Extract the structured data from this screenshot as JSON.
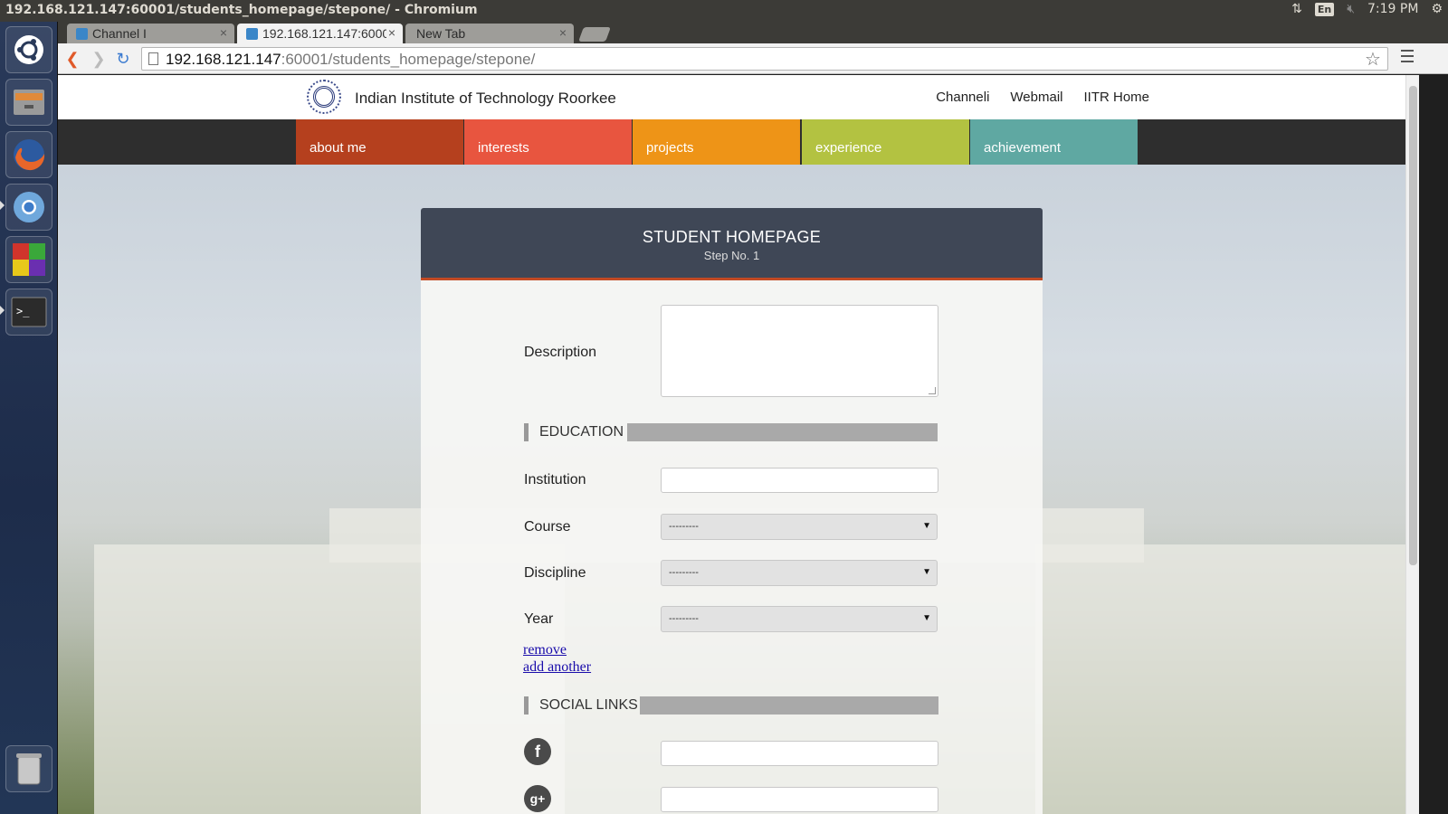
{
  "window": {
    "title": "192.168.121.147:60001/students_homepage/stepone/ - Chromium"
  },
  "tray": {
    "lang": "En",
    "clock": "7:19 PM"
  },
  "browser": {
    "tabs": [
      {
        "label": "Channel I"
      },
      {
        "label": "192.168.121.147:6000"
      },
      {
        "label": "New Tab"
      }
    ],
    "url_host": "192.168.121.147",
    "url_rest": ":60001/students_homepage/stepone/"
  },
  "site": {
    "title": "Indian Institute of Technology Roorkee",
    "links": [
      "Channeli",
      "Webmail",
      "IITR Home"
    ],
    "nav": [
      {
        "label": "about me",
        "color": "#b5401e"
      },
      {
        "label": "interests",
        "color": "#e8553f"
      },
      {
        "label": "projects",
        "color": "#ee9417"
      },
      {
        "label": "experience",
        "color": "#b3c241"
      },
      {
        "label": "achievement",
        "color": "#5fa8a2"
      }
    ]
  },
  "form": {
    "heading": "STUDENT HOMEPAGE",
    "step": "Step No. 1",
    "description_label": "Description",
    "education_section": "EDUCATION",
    "institution_label": "Institution",
    "course_label": "Course",
    "course_value": "---------",
    "discipline_label": "Discipline",
    "discipline_value": "---------",
    "year_label": "Year",
    "year_value": "---------",
    "remove_link": "remove",
    "add_link": "add another",
    "social_section": "SOCIAL LINKS"
  }
}
